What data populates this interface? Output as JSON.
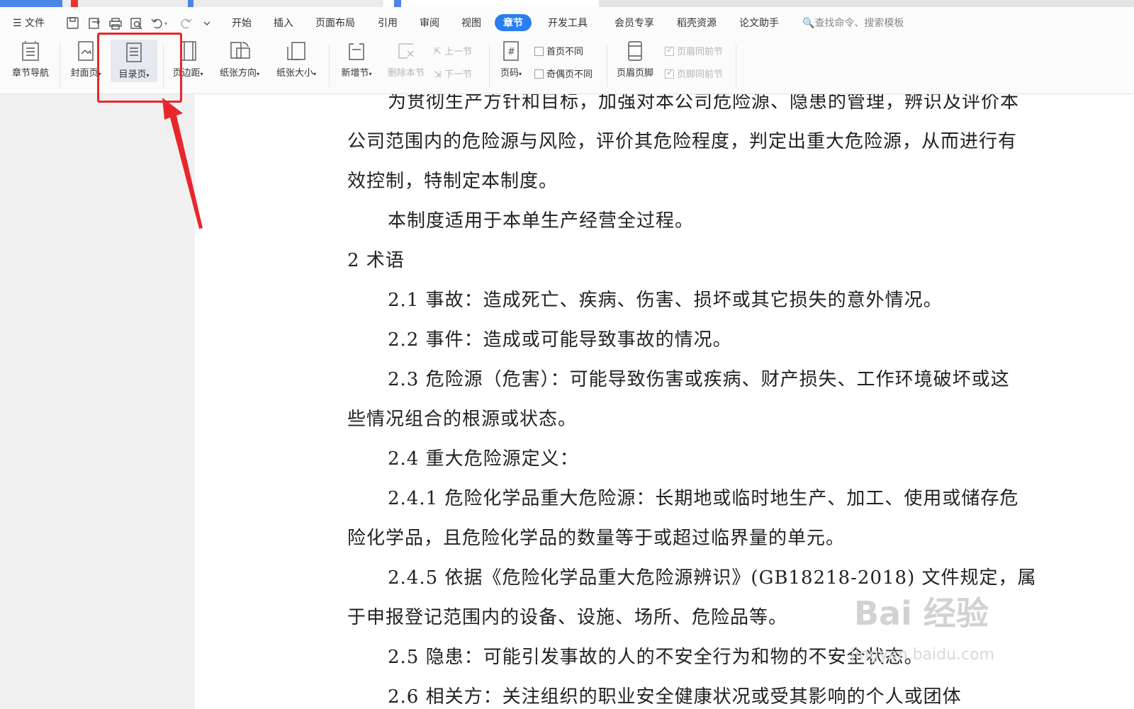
{
  "menubar": {
    "file_label": "文件",
    "tabs": [
      "开始",
      "插入",
      "页面布局",
      "引用",
      "审阅",
      "视图",
      "章节",
      "开发工具",
      "会员专享",
      "稻壳资源",
      "论文助手"
    ],
    "active_tab": "章节",
    "search_placeholder": "查找命令、搜索模板"
  },
  "ribbon": {
    "chapter_nav": "章节导航",
    "cover": "封面页",
    "toc": "目录页",
    "margins": "页边距",
    "orientation": "纸张方向",
    "size": "纸张大小",
    "new_section": "新增节",
    "delete_section": "删除本节",
    "prev_section": "上一节",
    "next_section": "下一节",
    "page_number": "页码",
    "first_page_diff": "首页不同",
    "odd_even_diff": "奇偶页不同",
    "header_footer": "页眉页脚",
    "header_same_prev": "页眉同前节",
    "footer_same_prev": "页脚同前节"
  },
  "document": {
    "lines": [
      "为贯彻生产方针和目标，加强对本公司危险源、隐患的管理，辨识及评价本",
      "公司范围内的危险源与风险，评价其危险程度，判定出重大危险源，从而进行有",
      "效控制，特制定本制度。",
      "本制度适用于本单生产经营全过程。",
      "2 术语",
      "2.1 事故：造成死亡、疾病、伤害、损坏或其它损失的意外情况。",
      "2.2 事件：造成或可能导致事故的情况。",
      "2.3 危险源（危害）：可能导致伤害或疾病、财产损失、工作环境破坏或这",
      "些情况组合的根源或状态。",
      "2.4 重大危险源定义：",
      "2.4.1 危险化学品重大危险源：长期地或临时地生产、加工、使用或储存危",
      "险化学品，且危险化学品的数量等于或超过临界量的单元。",
      "2.4.5 依据《危险化学品重大危险源辨识》(GB18218-2018) 文件规定，属",
      "于申报登记范围内的设备、设施、场所、危险品等。",
      "2.5 隐患：可能引发事故的人的不安全行为和物的不安全状态。",
      "2.6 相关方：关注组织的职业安全健康状况或受其影响的个人或团体"
    ]
  },
  "watermark": {
    "logo": "Bai 经验",
    "url": "jingyan.baidu.com"
  },
  "colors": {
    "accent": "#2a7ef1",
    "highlight": "#e8272b"
  }
}
